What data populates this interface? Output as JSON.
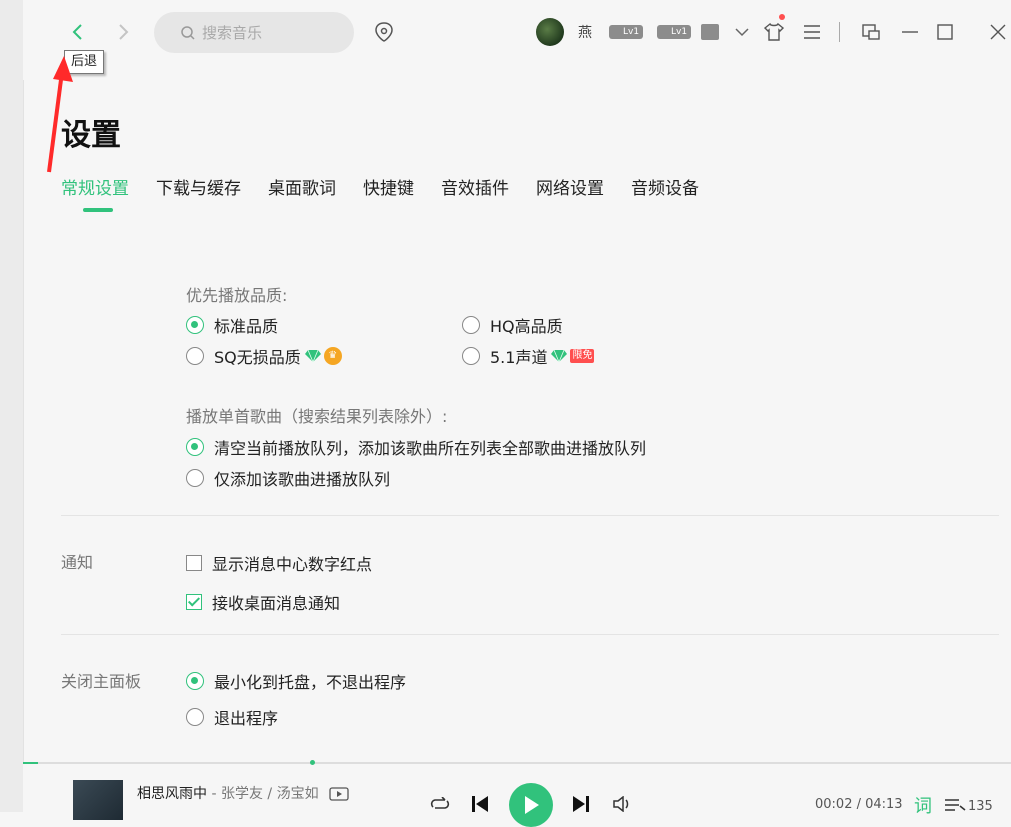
{
  "nav": {
    "tooltip": "后退"
  },
  "search": {
    "placeholder": "搜索音乐"
  },
  "user": {
    "name": "燕",
    "badge1": "Lv1",
    "badge2": "Lv1"
  },
  "page": {
    "title": "设置"
  },
  "tabs": [
    {
      "label": "常规设置",
      "active": true
    },
    {
      "label": "下载与缓存"
    },
    {
      "label": "桌面歌词"
    },
    {
      "label": "快捷键"
    },
    {
      "label": "音效插件"
    },
    {
      "label": "网络设置"
    },
    {
      "label": "音频设备"
    }
  ],
  "quality": {
    "heading": "优先播放品质:",
    "options": [
      {
        "label": "标准品质",
        "selected": true
      },
      {
        "label": "HQ高品质",
        "selected": false
      },
      {
        "label": "SQ无损品质",
        "selected": false
      },
      {
        "label": "5.1声道",
        "selected": false,
        "tag": "限免"
      }
    ]
  },
  "single_play": {
    "heading": "播放单首歌曲（搜索结果列表除外）:",
    "options": [
      {
        "label": "清空当前播放队列，添加该歌曲所在列表全部歌曲进播放队列",
        "selected": true
      },
      {
        "label": "仅添加该歌曲进播放队列",
        "selected": false
      }
    ]
  },
  "notify": {
    "label": "通知",
    "options": [
      {
        "label": "显示消息中心数字红点",
        "checked": false
      },
      {
        "label": "接收桌面消息通知",
        "checked": true
      }
    ]
  },
  "close_panel": {
    "label": "关闭主面板",
    "options": [
      {
        "label": "最小化到托盘，不退出程序",
        "selected": true
      },
      {
        "label": "退出程序",
        "selected": false
      }
    ]
  },
  "player": {
    "song": "相思风雨中",
    "artist": " - 张学友 / 汤宝如",
    "time": "00:02 / 04:13",
    "lyric": "词",
    "queue_count": "135"
  },
  "colors": {
    "accent": "#31c27c",
    "arrow": "#ff2a2a"
  }
}
